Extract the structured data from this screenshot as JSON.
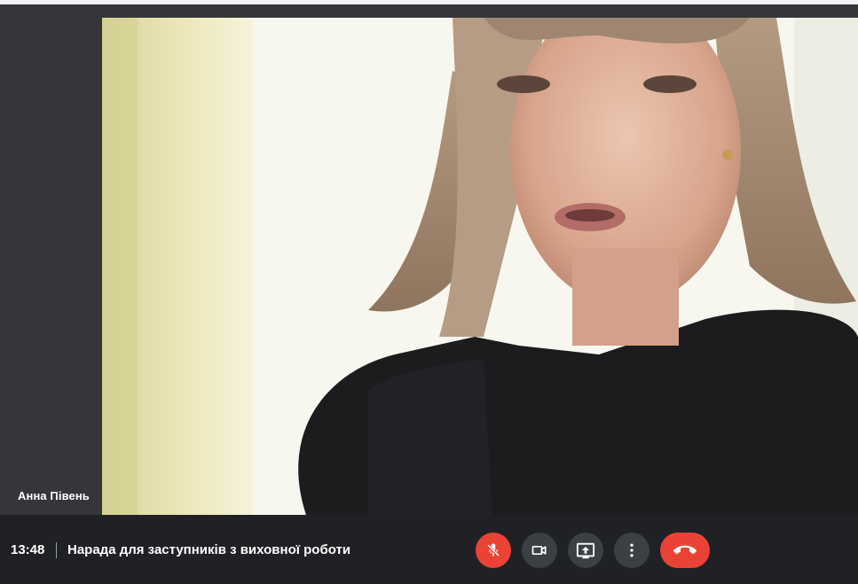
{
  "participant": {
    "name": "Анна Півень"
  },
  "meeting": {
    "time": "13:48",
    "title": "Нарада для заступників з виховної роботи"
  },
  "controls": {
    "mic": {
      "icon": "mic-off-icon",
      "state": "muted",
      "color": "#ea4335"
    },
    "camera": {
      "icon": "videocam-icon"
    },
    "present": {
      "icon": "present-screen-icon"
    },
    "more": {
      "icon": "more-vert-icon"
    },
    "leave": {
      "icon": "call-end-icon",
      "color": "#ea4335"
    }
  },
  "colors": {
    "background": "#202124",
    "stage": "#35363a",
    "button": "#3c4043",
    "danger": "#ea4335"
  }
}
